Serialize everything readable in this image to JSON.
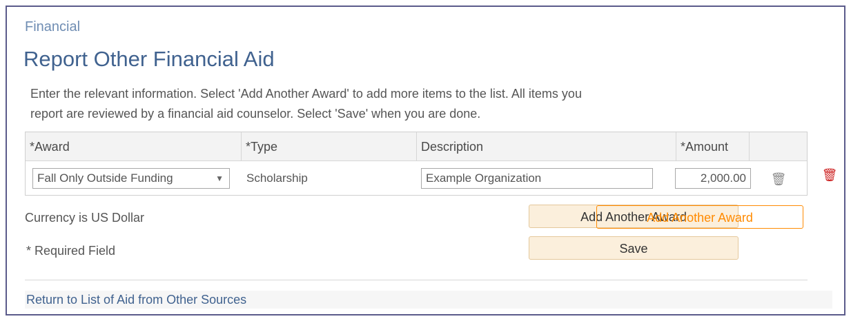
{
  "breadcrumb": {
    "label": "Financial"
  },
  "page": {
    "title": "Report Other Financial Aid"
  },
  "instructions": {
    "line1": "Enter the relevant information. Select 'Add Another Award' to add more items to the list. All items you",
    "line2": "report are reviewed by a financial aid counselor.  Select 'Save' when you are done."
  },
  "table": {
    "columns": [
      {
        "label": "*Award"
      },
      {
        "label": "*Type"
      },
      {
        "label": "Description"
      },
      {
        "label": "*Amount"
      }
    ],
    "rows": [
      {
        "award": "Fall Only Outside Funding",
        "type": "Scholarship",
        "description": "Example Organization",
        "amount": "2,000.00"
      }
    ]
  },
  "currency": {
    "label": "Currency is US Dollar"
  },
  "buttons": {
    "add_another_award": "Add Another Award",
    "save": "Save"
  },
  "required": {
    "label": "* Required Field"
  },
  "links": {
    "return_to_list": "Return to List of Aid from Other Sources"
  },
  "icons": {
    "dropdown": "chevron-down-icon",
    "trash": "trash-icon",
    "delete": "delete-icon"
  },
  "colors": {
    "title": "#40628f",
    "breadcrumb": "#6f8db3",
    "button_bg": "#fbefdc",
    "delete_icon": "#cc1f1f"
  }
}
